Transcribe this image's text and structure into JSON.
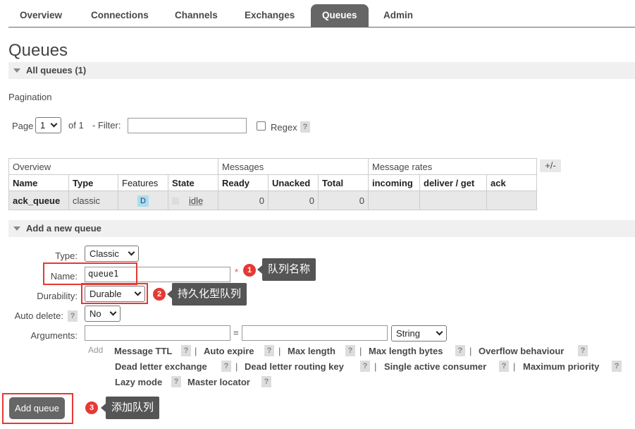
{
  "nav": {
    "tabs": [
      "Overview",
      "Connections",
      "Channels",
      "Exchanges",
      "Queues",
      "Admin"
    ],
    "active": "Queues"
  },
  "page_title": "Queues",
  "all_queues_label": "All queues (1)",
  "pagination": {
    "label": "Pagination",
    "page_label": "Page",
    "page_value": "1",
    "of_label": "of 1",
    "filter_label": "- Filter:",
    "filter_value": "",
    "regex_label": "Regex",
    "help": "?"
  },
  "table": {
    "groups": [
      "Overview",
      "Messages",
      "Message rates"
    ],
    "plus_minus": "+/-",
    "columns": [
      "Name",
      "Type",
      "Features",
      "State",
      "Ready",
      "Unacked",
      "Total",
      "incoming",
      "deliver / get",
      "ack"
    ],
    "rows": [
      {
        "name": "ack_queue",
        "type": "classic",
        "features": "D",
        "state": "idle",
        "ready": "0",
        "unacked": "0",
        "total": "0",
        "incoming": "",
        "deliver_get": "",
        "ack": ""
      }
    ]
  },
  "add_queue": {
    "section_label": "Add a new queue",
    "type_label": "Type:",
    "type_value": "Classic",
    "name_label": "Name:",
    "name_value": "queue1",
    "required_mark": "*",
    "durability_label": "Durability:",
    "durability_value": "Durable",
    "auto_delete_label": "Auto delete:",
    "auto_delete_value": "No",
    "arguments_label": "Arguments:",
    "equals": "=",
    "arg_type_value": "String",
    "add_label": "Add",
    "arg_links": [
      "Message TTL",
      "Auto expire",
      "Max length",
      "Max length bytes",
      "Overflow behaviour",
      "Dead letter exchange",
      "Dead letter routing key",
      "Single active consumer",
      "Maximum priority",
      "Lazy mode",
      "Master locator"
    ],
    "separator": "|",
    "submit_label": "Add queue"
  },
  "annotations": {
    "callouts": [
      {
        "number": "1",
        "text": "队列名称"
      },
      {
        "number": "2",
        "text": "持久化型队列"
      },
      {
        "number": "3",
        "text": "添加队列"
      }
    ],
    "highlight_color": "#e53935"
  }
}
